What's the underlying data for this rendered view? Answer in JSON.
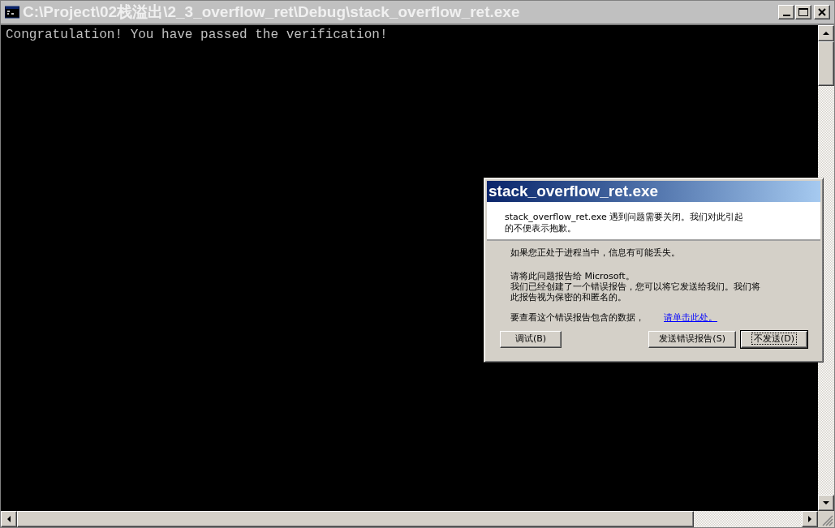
{
  "window": {
    "title": "C:\\Project\\02栈溢出\\2_3_overflow_ret\\Debug\\stack_overflow_ret.exe",
    "active": false
  },
  "console": {
    "lines": [
      "Congratulation! You have passed the verification!"
    ]
  },
  "dialog": {
    "title": "stack_overflow_ret.exe",
    "header_lines": [
      "stack_overflow_ret.exe 遇到问题需要关闭。我们对此引起",
      "的不便表示抱歉。"
    ],
    "body": [
      {
        "kind": "text",
        "lines": [
          "如果您正处于进程当中，信息有可能丢失。"
        ]
      },
      {
        "kind": "text",
        "lines": [
          "请将此问题报告给 Microsoft。",
          "我们已经创建了一个错误报告，您可以将它发送给我们。我们将",
          "此报告视为保密的和匿名的。"
        ]
      },
      {
        "kind": "link_row",
        "text": "要查看这个错误报告包含的数据，",
        "link": "请单击此处。"
      }
    ],
    "buttons": [
      {
        "label": "调试(B)",
        "focused": false
      },
      {
        "label": "发送错误报告(S)",
        "focused": false
      },
      {
        "label": "不发送(D)",
        "focused": true
      }
    ]
  }
}
